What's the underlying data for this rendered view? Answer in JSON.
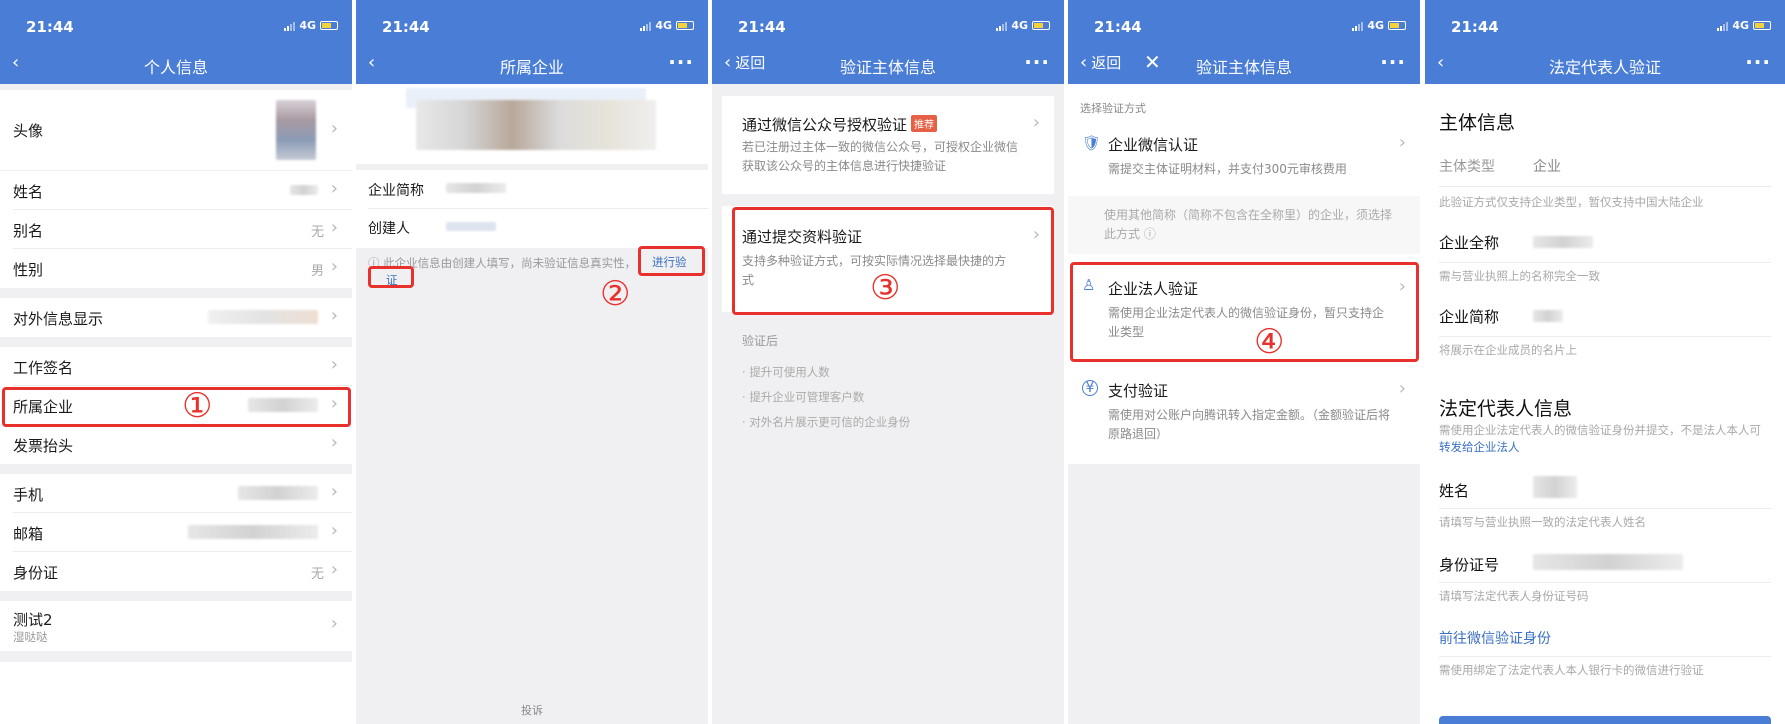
{
  "status": {
    "time": "21:44",
    "network": "4G"
  },
  "panel1": {
    "title": "个人信息",
    "rows": [
      {
        "label": "头像",
        "value": ""
      },
      {
        "label": "姓名",
        "value": ""
      },
      {
        "label": "别名",
        "value": "无"
      },
      {
        "label": "性别",
        "value": "男"
      },
      {
        "label": "对外信息显示",
        "value": ""
      },
      {
        "label": "工作签名",
        "value": ""
      },
      {
        "label": "所属企业",
        "value": ""
      },
      {
        "label": "发票抬头",
        "value": ""
      },
      {
        "label": "手机",
        "value": ""
      },
      {
        "label": "邮箱",
        "value": ""
      },
      {
        "label": "身份证",
        "value": "无"
      },
      {
        "label": "测试2",
        "sublabel": "湿哒哒",
        "value": ""
      }
    ],
    "step_mark": "①"
  },
  "panel2": {
    "title": "所属企业",
    "company_short_label": "企业简称",
    "creator_label": "创建人",
    "notice": "此企业信息由创建人填写，尚未验证信息真实性，",
    "verify_link_a": "进行验",
    "verify_link_b": "证",
    "complaint": "投诉",
    "step_mark": "②"
  },
  "panel3": {
    "back": "返回",
    "title": "验证主体信息",
    "option_wechat": {
      "title": "通过微信公众号授权验证",
      "tag": "推荐",
      "desc": "若已注册过主体一致的微信公众号，可授权企业微信获取该公众号的主体信息进行快捷验证"
    },
    "option_submit": {
      "title": "通过提交资料验证",
      "desc": "支持多种验证方式，可按实际情况选择最快捷的方式"
    },
    "after_title": "验证后",
    "after_items": [
      "提升可使用人数",
      "提升企业可管理客户数",
      "对外名片展示更可信的企业身份"
    ],
    "step_mark": "③"
  },
  "panel4": {
    "back": "返回",
    "title": "验证主体信息",
    "section": "选择验证方式",
    "options": [
      {
        "title": "企业微信认证",
        "desc": "需提交主体证明材料，并支付300元审核费用"
      },
      {
        "title": "企业法人验证",
        "desc": "需使用企业法定代表人的微信验证身份，暂只支持企业类型"
      },
      {
        "title": "支付验证",
        "desc": "需使用对公账户向腾讯转入指定金额。（金额验证后将原路退回）"
      }
    ],
    "note": "使用其他简称（简称不包含在全称里）的企业，须选择此方式",
    "step_mark": "④"
  },
  "panel5": {
    "title": "法定代表人验证",
    "subject_heading": "主体信息",
    "subject_type_label": "主体类型",
    "subject_type_value": "企业",
    "subject_type_hint": "此验证方式仅支持企业类型，暂仅支持中国大陆企业",
    "fullname_label": "企业全称",
    "fullname_hint": "需与营业执照上的名称完全一致",
    "shortname_label": "企业简称",
    "shortname_hint": "将展示在企业成员的名片上",
    "legal_heading": "法定代表人信息",
    "legal_desc": "需使用企业法定代表人的微信验证身份并提交，不是法人本人可",
    "legal_link": "转发给企业法人",
    "name_label": "姓名",
    "name_hint": "请填写与营业执照一致的法定代表人姓名",
    "id_label": "身份证号",
    "id_hint": "请填写法定代表人身份证号码",
    "wechat_verify": "前往微信验证身份",
    "wechat_hint": "需使用绑定了法定代表人本人银行卡的微信进行验证"
  },
  "colors": {
    "brand": "#4a7dd6",
    "highlight": "#e8312c",
    "tag": "#e66046"
  }
}
